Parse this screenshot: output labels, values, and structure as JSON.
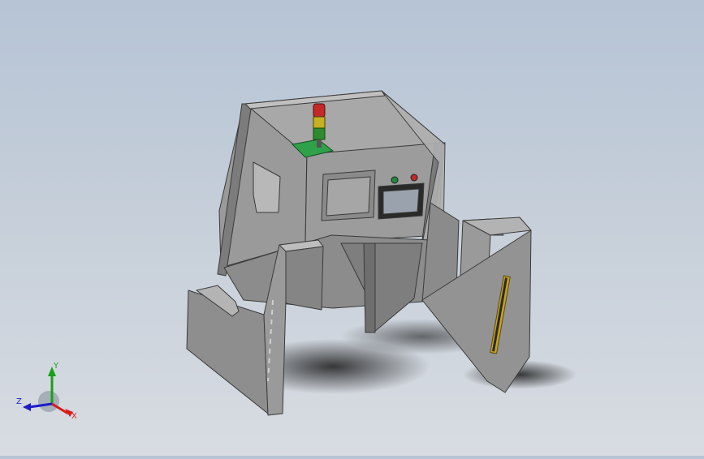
{
  "viewport": {
    "background_top": "#b6c4d6",
    "background_bottom": "#d8dce2",
    "model_fill": "#8f8f8f",
    "model_edge": "#3a3a3a"
  },
  "triad": {
    "x_label": "X",
    "y_label": "Y",
    "z_label": "Z",
    "x_color": "#d81b1b",
    "y_color": "#19a019",
    "z_color": "#1c1cc8"
  },
  "model": {
    "stack_light_colors": [
      "#c62828",
      "#c8b020",
      "#2e8b2e"
    ],
    "indicator_colors": [
      "#1f8a3a",
      "#c62828"
    ],
    "mount_plate_color": "#2fa14a",
    "light_curtain_color": "#c8a11e"
  }
}
